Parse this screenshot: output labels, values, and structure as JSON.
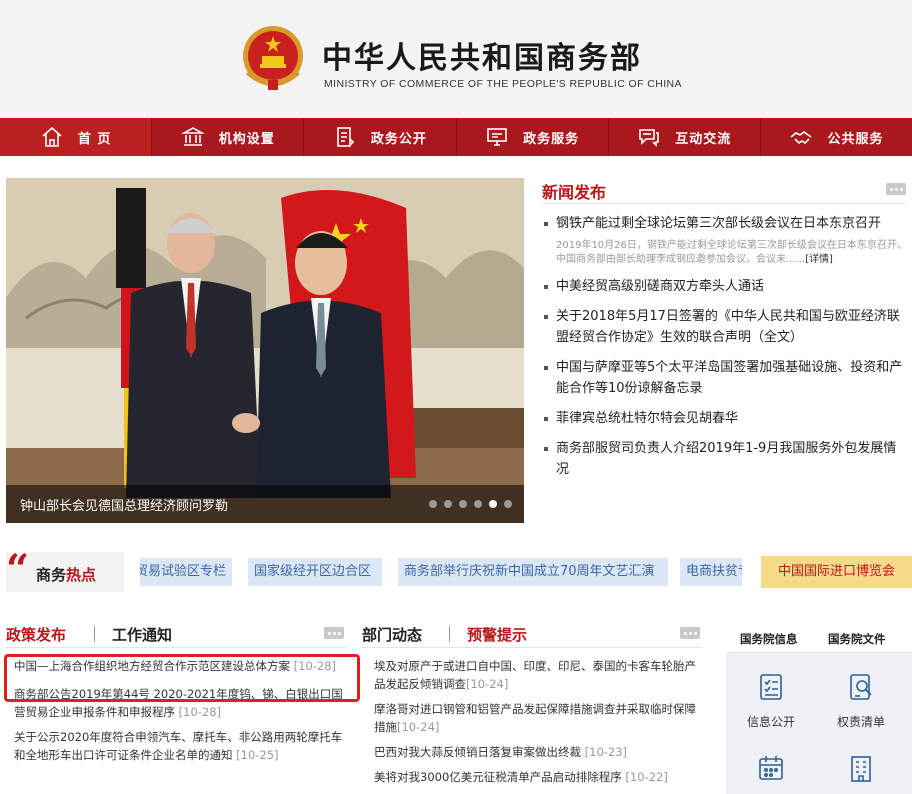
{
  "header": {
    "title": "中华人民共和国商务部",
    "subtitle": "MINISTRY OF COMMERCE OF THE PEOPLE'S REPUBLIC OF CHINA"
  },
  "nav": [
    {
      "label": "首 页",
      "icon": "home-icon"
    },
    {
      "label": "机构设置",
      "icon": "institution-icon"
    },
    {
      "label": "政务公开",
      "icon": "document-icon"
    },
    {
      "label": "政务服务",
      "icon": "monitor-icon"
    },
    {
      "label": "互动交流",
      "icon": "chat-icon"
    },
    {
      "label": "公共服务",
      "icon": "handshake-icon"
    }
  ],
  "carousel": {
    "caption": "钟山部长会见德国总理经济顾问罗勒",
    "slide_count": 6,
    "active_slide": 5
  },
  "news": {
    "title": "新闻发布",
    "items": [
      {
        "text": "钢铁产能过剩全球论坛第三次部长级会议在日本东京召开",
        "summary": "2019年10月26日，钢铁产能过剩全球论坛第三次部长级会议在日本东京召开。中国商务部由部长助理李成钢应邀参加会议。会议未......",
        "detail": "[详情]"
      },
      {
        "text": "中美经贸高级别磋商双方牵头人通话"
      },
      {
        "text": "关于2018年5月17日签署的《中华人民共和国与欧亚经济联盟经贸合作协定》生效的联合声明（全文）"
      },
      {
        "text": "中国与萨摩亚等5个太平洋岛国签署加强基础设施、投资和产能合作等10份谅解备忘录"
      },
      {
        "text": "菲律宾总统杜特尔特会见胡春华"
      },
      {
        "text": "商务部服贸司负责人介绍2019年1-9月我国服务外包发展情况"
      }
    ]
  },
  "hot_bar": {
    "label_prefix": "商务",
    "label_suffix": "热点",
    "tags": [
      "贸易试验区专栏",
      "国家级经开区边合区",
      "商务部举行庆祝新中国成立70周年文艺汇演",
      "电商扶贫专"
    ],
    "gold_tag": "中国国际进口博览会"
  },
  "policy": {
    "tab_active": "政策发布",
    "tab_other": "工作通知",
    "items": [
      {
        "text": "中国—上海合作组织地方经贸合作示范区建设总体方案",
        "date": "[10-28]"
      },
      {
        "text": "商务部公告2019年第44号 2020-2021年度钨、锑、白银出口国营贸易企业申报条件和申报程序",
        "date": "[10-28]"
      },
      {
        "text": "关于公示2020年度符合申领汽车、摩托车、非公路用两轮摩托车和全地形车出口许可证条件企业名单的通知",
        "date": "[10-25]"
      }
    ]
  },
  "dept": {
    "tab_active": "部门动态",
    "tab_other": "预警提示",
    "items": [
      {
        "text": "埃及对原产于或进口自中国、印度、印尼、泰国的卡客车轮胎产品发起反倾销调查",
        "date": "[10-24]"
      },
      {
        "text": "摩洛哥对进口钢管和铝管产品发起保障措施调查并采取临时保障措施",
        "date": "[10-24]"
      },
      {
        "text": "巴西对我大蒜反倾销日落复审案做出终裁",
        "date": "[10-23]"
      },
      {
        "text": "美将对我3000亿美元征税清单产品启动排除程序",
        "date": "[10-22]"
      }
    ]
  },
  "gov": {
    "tabs": [
      "国务院信息",
      "国务院文件"
    ],
    "items": [
      {
        "label": "信息公开",
        "icon": "checklist-icon"
      },
      {
        "label": "权责清单",
        "icon": "search-doc-icon"
      },
      {
        "label": "",
        "icon": "calendar-icon"
      },
      {
        "label": "",
        "icon": "building-icon"
      }
    ]
  },
  "colors": {
    "brand_red": "#a8181c",
    "accent_red": "#b8161a",
    "tag_blue": "#dbe7f4",
    "gold": "#f6d989"
  }
}
